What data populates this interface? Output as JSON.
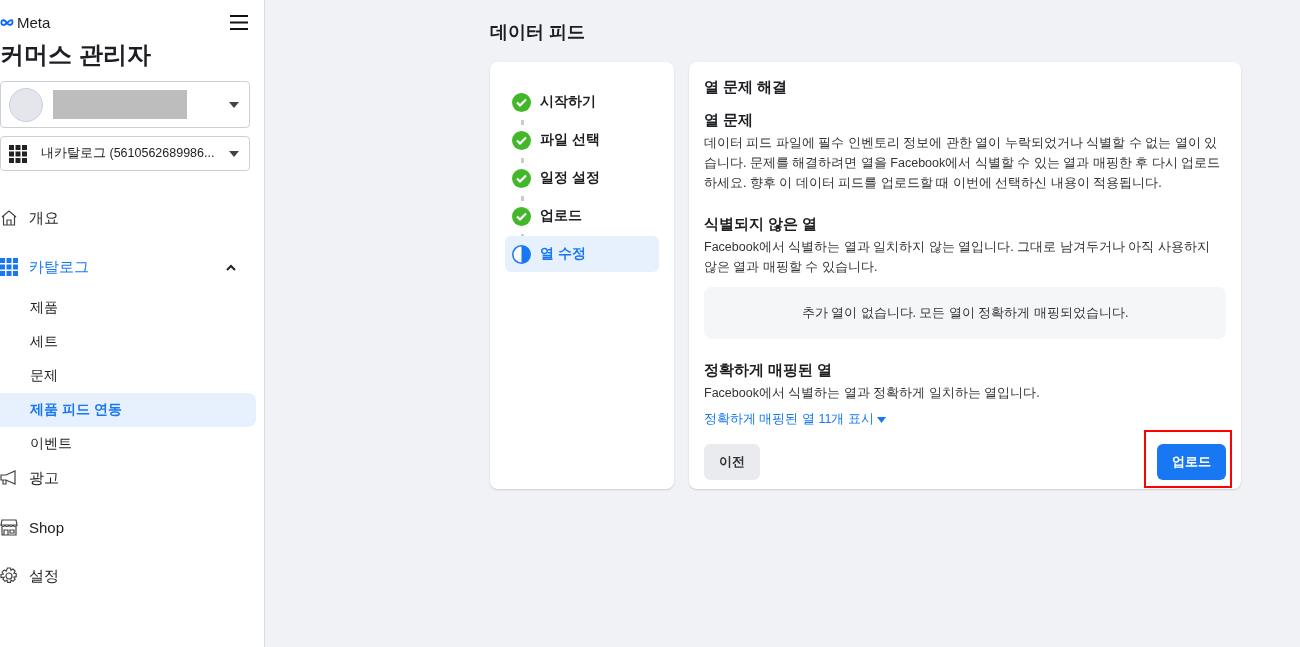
{
  "sidebar": {
    "brand": "Meta",
    "title": "커머스 관리자",
    "account_selector": {
      "kind": "redacted"
    },
    "catalog_selector": {
      "label": "내카탈로그 (5610562689986..."
    },
    "nav": [
      {
        "label": "개요",
        "active": false
      },
      {
        "label": "카탈로그",
        "active": true,
        "expanded": true,
        "children": [
          {
            "label": "제품",
            "selected": false
          },
          {
            "label": "세트",
            "selected": false
          },
          {
            "label": "문제",
            "selected": false
          },
          {
            "label": "제품 피드 연동",
            "selected": true
          },
          {
            "label": "이벤트",
            "selected": false
          }
        ]
      },
      {
        "label": "광고",
        "active": false
      },
      {
        "label": "Shop",
        "active": false
      },
      {
        "label": "설정",
        "active": false
      }
    ]
  },
  "page_title": "데이터 피드",
  "steps": [
    {
      "label": "시작하기",
      "kind": "done",
      "selected": false
    },
    {
      "label": "파일 선택",
      "kind": "done",
      "selected": false
    },
    {
      "label": "일정 설정",
      "kind": "done",
      "selected": false
    },
    {
      "label": "업로드",
      "kind": "done",
      "selected": false
    },
    {
      "label": "열 수정",
      "kind": "current",
      "selected": true
    }
  ],
  "panel": {
    "title": "열 문제 해결",
    "sections": [
      {
        "heading": "열 문제",
        "text": "데이터 피드 파일에 필수 인벤토리 정보에 관한 열이 누락되었거나 식별할 수 없는 열이 있습니다. 문제를 해결하려면 열을 Facebook에서 식별할 수 있는 열과 매핑한 후 다시 업로드하세요. 향후 이 데이터 피드를 업로드할 때 이번에 선택하신 내용이 적용됩니다."
      },
      {
        "heading": "식별되지 않은 열",
        "text": "Facebook에서 식별하는 열과 일치하지 않는 열입니다. 그대로 남겨두거나 아직 사용하지 않은 열과 매핑할 수 있습니다.",
        "notice": "추가 열이 없습니다. 모든 열이 정확하게 매핑되었습니다."
      },
      {
        "heading": "정확하게 매핑된 열",
        "text": "Facebook에서 식별하는 열과 정확하게 일치하는 열입니다.",
        "link": "정확하게 매핑된 열 11개 표시"
      }
    ],
    "back_button": "이전",
    "upload_button": {
      "label": "업로드",
      "highlighted": true
    }
  }
}
